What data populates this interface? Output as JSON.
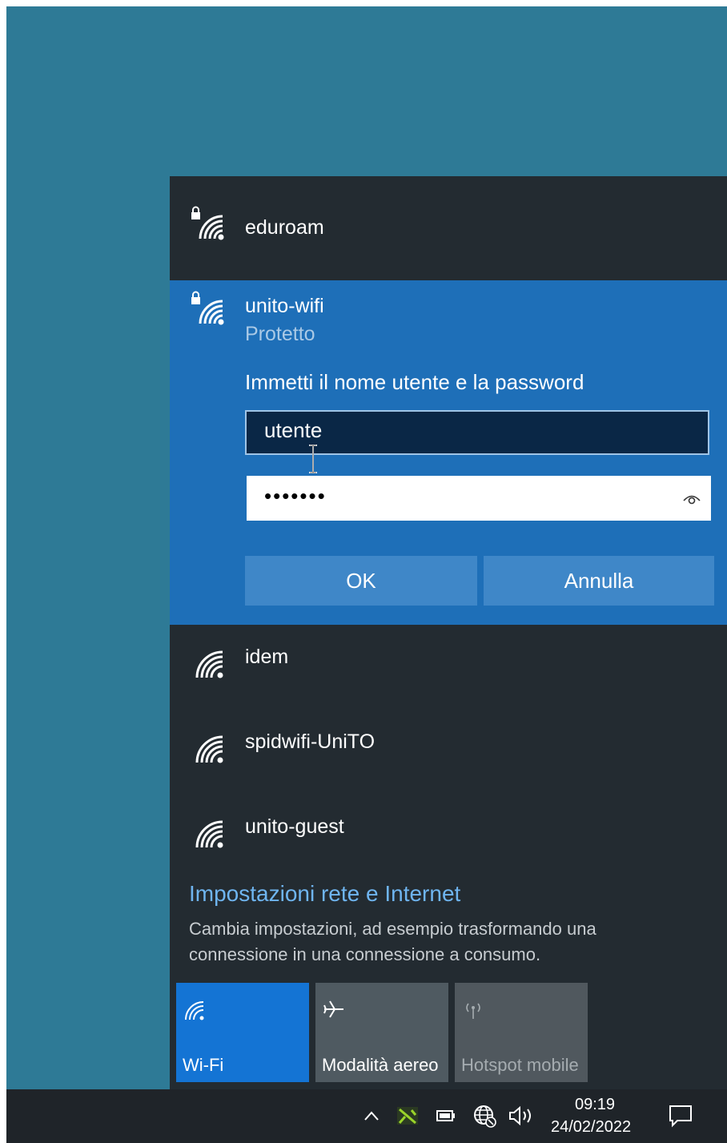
{
  "networks": {
    "eduroam": {
      "name": "eduroam",
      "icon": "wifi-secured-icon"
    },
    "active": {
      "name": "unito-wifi",
      "status": "Protetto",
      "prompt": "Immetti il nome utente e la password",
      "username_value": "utente",
      "password_mask": "•••••••",
      "ok_label": "OK",
      "cancel_label": "Annulla"
    },
    "idem": {
      "name": "idem",
      "icon": "wifi-icon"
    },
    "spid": {
      "name": "spidwifi-UniTO",
      "icon": "wifi-icon"
    },
    "guest": {
      "name": "unito-guest",
      "icon": "wifi-icon"
    }
  },
  "settings": {
    "link": "Impostazioni rete e Internet",
    "description": "Cambia impostazioni, ad esempio trasformando una connessione in una connessione a consumo."
  },
  "tiles": {
    "wifi": "Wi-Fi",
    "aereo": "Modalità aereo",
    "hotspot": "Hotspot mobile"
  },
  "taskbar": {
    "time": "09:19",
    "date": "24/02/2022"
  },
  "colors": {
    "desktop": "#2e7a96",
    "flyout": "#232b31",
    "selected_network": "#1e6fb8",
    "accent_link": "#6fb5f0",
    "wifi_tile_active": "#1474d4"
  }
}
